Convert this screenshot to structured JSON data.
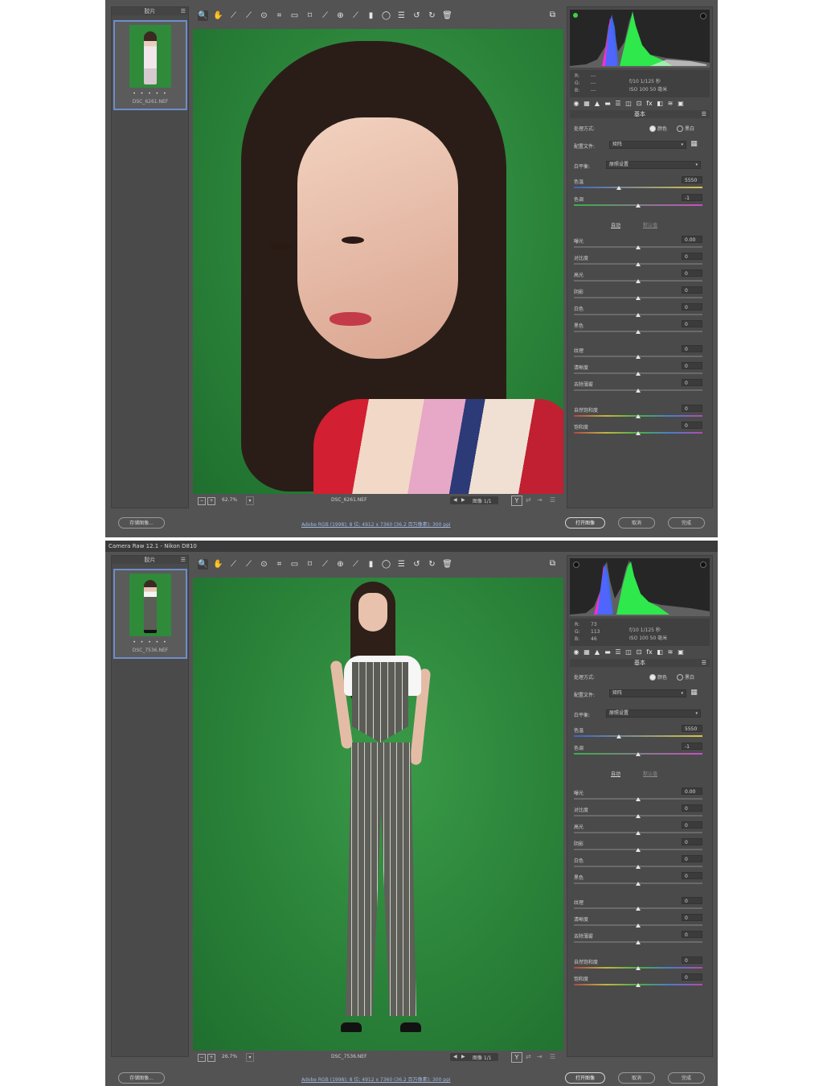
{
  "windows": [
    {
      "title": "",
      "filmstrip": {
        "title": "胶片",
        "stars": "• • • • •",
        "filename": "DSC_6261.NEF"
      },
      "readout": {
        "r_label": "R:",
        "g_label": "G:",
        "b_label": "B:",
        "r": "---",
        "g": "---",
        "b": "---",
        "aperture_shutter": "f/10   1/125 秒",
        "iso_lens": "ISO 100   50 毫米"
      },
      "panel_title": "基本",
      "process": {
        "label": "处理方式:",
        "color": "颜色",
        "bw": "黑白"
      },
      "profile": {
        "label": "配置文件:",
        "value": "矩阵"
      },
      "wb": {
        "label": "白平衡:",
        "value": "原照设置"
      },
      "temp": {
        "label": "色温",
        "value": "5550"
      },
      "tint": {
        "label": "色调",
        "value": "-1"
      },
      "auto": "自动",
      "default": "默认值",
      "sliders": [
        {
          "label": "曝光",
          "value": "0.00"
        },
        {
          "label": "对比度",
          "value": "0"
        },
        {
          "label": "高光",
          "value": "0"
        },
        {
          "label": "阴影",
          "value": "0"
        },
        {
          "label": "白色",
          "value": "0"
        },
        {
          "label": "黑色",
          "value": "0"
        },
        {
          "label": "纹理",
          "value": "0"
        },
        {
          "label": "清晰度",
          "value": "0"
        },
        {
          "label": "去除薄雾",
          "value": "0"
        },
        {
          "label": "自然饱和度",
          "value": "0"
        },
        {
          "label": "饱和度",
          "value": "0"
        }
      ],
      "preview": {
        "zoom": "62.7%",
        "filename": "DSC_6261.NEF",
        "nav_prev": "◀",
        "nav_next": "▶",
        "image_count": "图像 1/1",
        "y": "Y"
      },
      "bottom": {
        "save": "存储图像...",
        "workflow": "Adobe RGB (1998); 8 位; 4912 x 7360 (36.2 百万像素); 300 ppi",
        "open": "打开图像",
        "cancel": "取消",
        "done": "完成"
      }
    },
    {
      "title": "Camera Raw 12.1 - Nikon D810",
      "filmstrip": {
        "title": "胶片",
        "stars": "• • • • •",
        "filename": "DSC_7536.NEF"
      },
      "readout": {
        "r_label": "R:",
        "g_label": "G:",
        "b_label": "B:",
        "r": "73",
        "g": "113",
        "b": "46",
        "aperture_shutter": "f/10   1/125 秒",
        "iso_lens": "ISO 100   50 毫米"
      },
      "panel_title": "基本",
      "process": {
        "label": "处理方式:",
        "color": "颜色",
        "bw": "黑白"
      },
      "profile": {
        "label": "配置文件:",
        "value": "矩阵"
      },
      "wb": {
        "label": "白平衡:",
        "value": "原照设置"
      },
      "temp": {
        "label": "色温",
        "value": "5550"
      },
      "tint": {
        "label": "色调",
        "value": "-1"
      },
      "auto": "自动",
      "default": "默认值",
      "sliders": [
        {
          "label": "曝光",
          "value": "0.00"
        },
        {
          "label": "对比度",
          "value": "0"
        },
        {
          "label": "高光",
          "value": "0"
        },
        {
          "label": "阴影",
          "value": "0"
        },
        {
          "label": "白色",
          "value": "0"
        },
        {
          "label": "黑色",
          "value": "0"
        },
        {
          "label": "纹理",
          "value": "0"
        },
        {
          "label": "清晰度",
          "value": "0"
        },
        {
          "label": "去除薄雾",
          "value": "0"
        },
        {
          "label": "自然饱和度",
          "value": "0"
        },
        {
          "label": "饱和度",
          "value": "0"
        }
      ],
      "preview": {
        "zoom": "26.7%",
        "filename": "DSC_7536.NEF",
        "nav_prev": "◀",
        "nav_next": "▶",
        "image_count": "图像 1/1",
        "y": "Y"
      },
      "bottom": {
        "save": "存储图像...",
        "workflow": "Adobe RGB (1998); 8 位; 4912 x 7360 (36.2 百万像素); 300 ppi",
        "open": "打开图像",
        "cancel": "取消",
        "done": "完成"
      }
    }
  ],
  "tools": [
    "zoom-icon",
    "hand-icon",
    "white-balance-icon",
    "color-sampler-icon",
    "target-adjust-icon",
    "crop-icon",
    "straighten-icon",
    "transform-icon",
    "spot-removal-icon",
    "red-eye-icon",
    "brush-icon",
    "graduated-filter-icon",
    "radial-filter-icon",
    "preferences-icon",
    "rotate-left-icon",
    "rotate-right-icon",
    "trash-icon"
  ],
  "tool_glyphs": [
    "🔍",
    "✋",
    "⟋",
    "⟋",
    "⊙",
    "⌗",
    "▭",
    "⌑",
    "⟋",
    "⊕",
    "⟋",
    "▮",
    "◯",
    "☰",
    "↺",
    "↻",
    "🗑"
  ],
  "panel_tab_glyphs": [
    "◉",
    "▦",
    "▲",
    "▬",
    "☰",
    "◫",
    "⊡",
    "fx",
    "◧",
    "≋",
    "▣"
  ],
  "colors": {
    "accent": "#6d8ecb",
    "backdrop": "#2c8a3e"
  }
}
